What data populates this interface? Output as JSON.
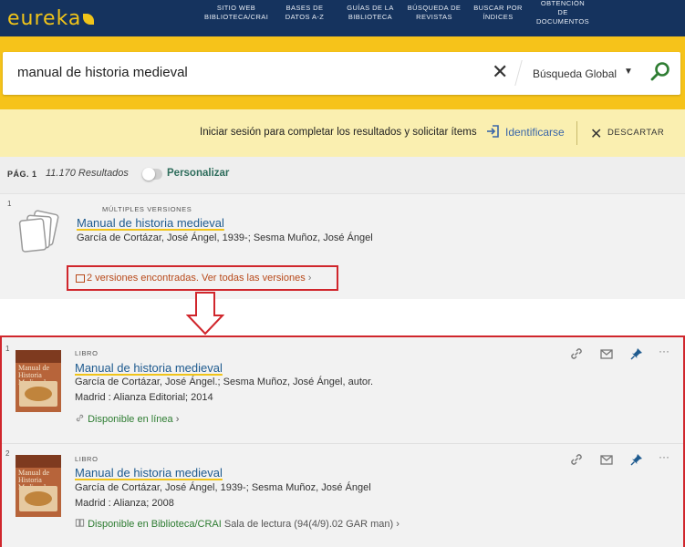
{
  "app": {
    "logo_text": "eureka",
    "nav": [
      {
        "label": "SITIO WEB\nBIBLIOTECA/CRAI"
      },
      {
        "label": "BASES DE\nDATOS A-Z"
      },
      {
        "label": "GUÍAS DE LA\nBIBLIOTECA"
      },
      {
        "label": "BÚSQUEDA DE\nREVISTAS"
      },
      {
        "label": "BUSCAR POR\nÍNDICES"
      },
      {
        "label": "OBTENCIÓN\nDE\nDOCUMENTOS"
      }
    ]
  },
  "search": {
    "value": "manual de historia medieval",
    "clear_glyph": "✕",
    "scope": "Búsqueda Global",
    "scope_caret": "▼"
  },
  "notice": {
    "text": "Iniciar sesión para completar los resultados y solicitar ítems",
    "login_label": "Identificarse",
    "dismiss_label": "DESCARTAR",
    "dismiss_glyph": "✕"
  },
  "results_header": {
    "page": "PÁG. 1",
    "count": "11.170 Resultados",
    "personalize": "Personalizar",
    "personalize_enabled": false
  },
  "results": [
    {
      "index": "1",
      "type": "MÚLTIPLES VERSIONES",
      "title": "Manual de historia medieval",
      "authors": "García de Cortázar, José Ángel, 1939-; Sesma Muñoz, José Ángel",
      "versions_link": "2 versiones encontradas. Ver todas las versiones",
      "chevron": "›"
    }
  ],
  "versions": [
    {
      "index": "1",
      "type": "LIBRO",
      "title": "Manual de historia medieval",
      "authors": "García de Cortázar, José Ángel.; Sesma Muñoz, José Ángel, autor.",
      "publication": "Madrid : Alianza Editorial; 2014",
      "availability": "Disponible en línea",
      "availability_status": "online",
      "chevron": "›",
      "cover_title": "Manual de\nHistoria\nMedieval"
    },
    {
      "index": "2",
      "type": "LIBRO",
      "title": "Manual de historia medieval",
      "authors": "García de Cortázar, José Ángel, 1939-; Sesma Muñoz, José Ángel",
      "publication": "Madrid : Alianza; 2008",
      "availability": "Disponible en Biblioteca/CRAI",
      "location": "Sala de lectura (94(4/9).02 GAR man)",
      "availability_status": "available",
      "chevron": "›",
      "cover_title": "Manual de\nHistoria\nMedieval"
    }
  ],
  "icons": {
    "link": "link-icon",
    "email": "email-icon",
    "pin": "pin-icon",
    "more": "more-icon",
    "more_glyph": "···"
  },
  "colors": {
    "nav_bg": "#15335e",
    "accent_yellow": "#f6c31a",
    "notice_bg": "#faefb0",
    "title_blue": "#1f5b8f",
    "available_green": "#2e7d32",
    "highlight_red": "#d0262c"
  }
}
